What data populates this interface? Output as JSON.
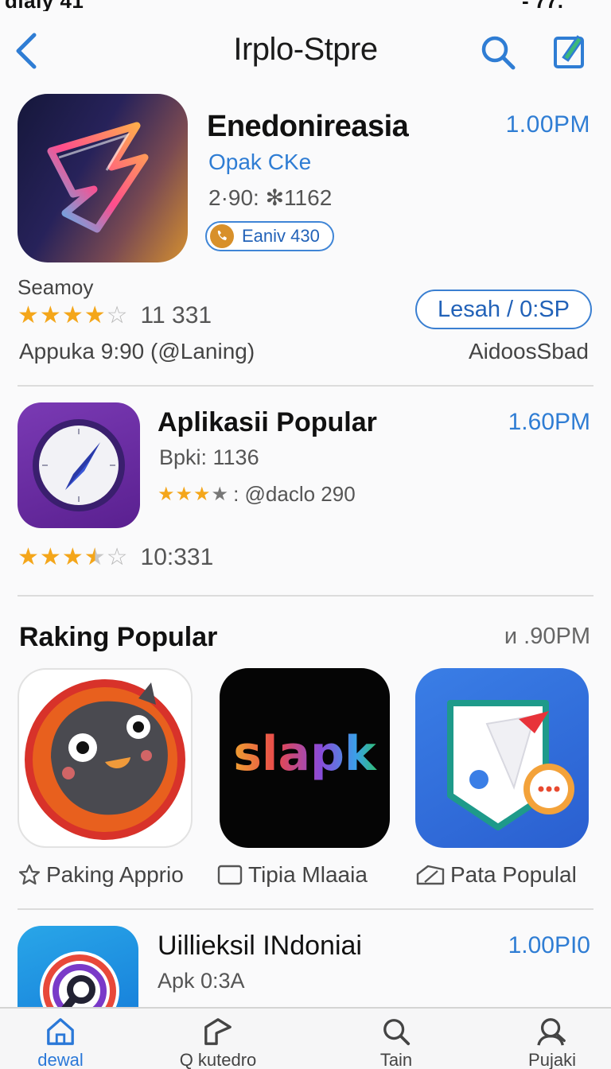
{
  "status_bar": {
    "left": "ɑlaiy 41",
    "right": "- 77."
  },
  "nav": {
    "title": "Irplo-Stpre"
  },
  "featured": {
    "name": "Enedonireasia",
    "time": "1.00PM",
    "developer": "Opak CKe",
    "meta": "2·90: ✻1162",
    "pill_label": "Eaniv 430",
    "section_label": "Seamoy",
    "rating_stars": 4.5,
    "rating_count": "11 331",
    "action_label": "Lesah / 0:SP",
    "footer_left": "Appuka 9:90  (@Laning)",
    "footer_right": "AidoosSbad"
  },
  "app2": {
    "name": "Aplikasii Popular",
    "time": "1.60PM",
    "meta": "Bpki: 1136",
    "rating_text": ": @daclo 290",
    "rating_stars": 4,
    "rating2_stars": 3.5,
    "rating2_count": "10:331"
  },
  "ranking": {
    "title": "Raking Popular",
    "time": "ᴎ .90PM",
    "tiles": [
      {
        "label": "Paking Apprio",
        "icon": "star-outline-icon"
      },
      {
        "label": "Tipia Mlaaia",
        "icon": "square-outline-icon",
        "logo_text": "slapk"
      },
      {
        "label": "Pata Populal",
        "icon": "ticket-icon"
      }
    ]
  },
  "app3": {
    "name": "Uillieksil INdoniai",
    "time": "1.00PI0",
    "meta": "Apk 0:3A"
  },
  "tabs": [
    {
      "label": "dewal",
      "icon": "home-icon",
      "active": true
    },
    {
      "label": "Q kutedro",
      "icon": "arrow-shape-icon",
      "active": false
    },
    {
      "label": "Tain",
      "icon": "search-icon",
      "active": false
    },
    {
      "label": "Pujaki",
      "icon": "person-search-icon",
      "active": false
    }
  ],
  "colors": {
    "accent": "#2f7dd4",
    "star": "#f4a61a",
    "text": "#1a1a1a"
  }
}
